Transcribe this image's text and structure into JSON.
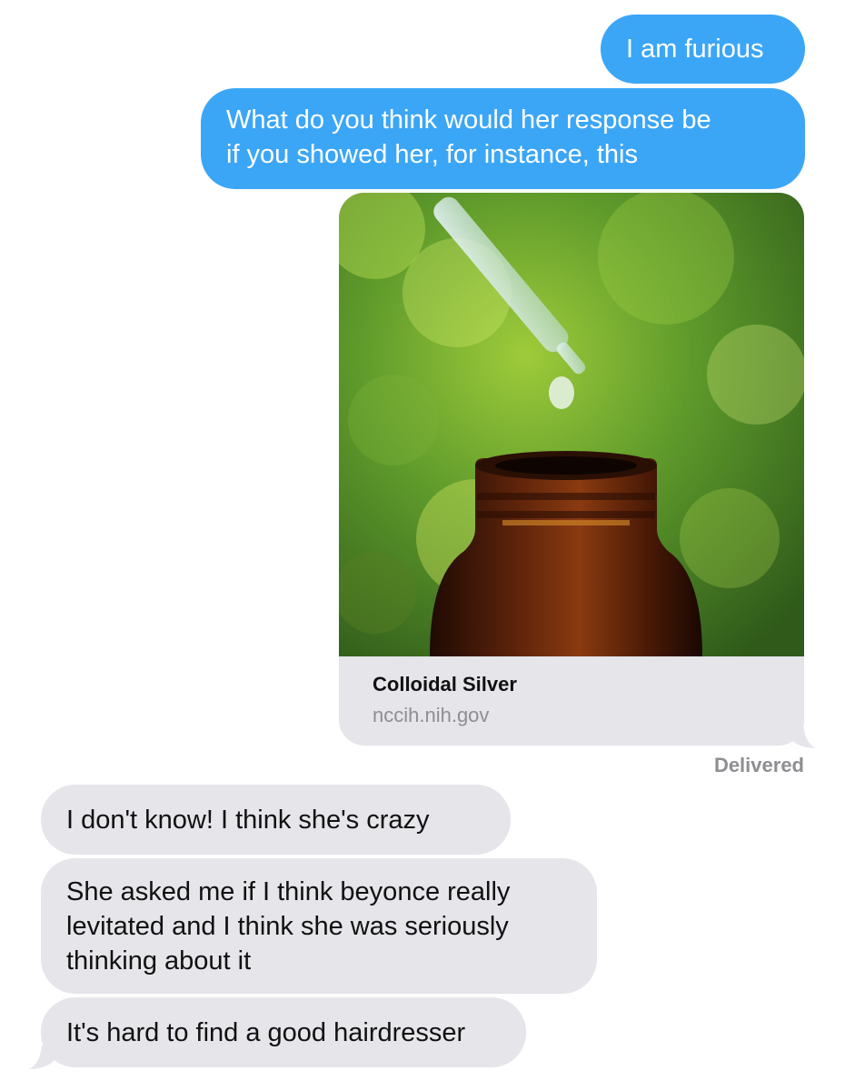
{
  "conversation": {
    "sent": [
      {
        "text": "I am furious"
      },
      {
        "line1": "What do you think would her response be",
        "line2": "if you showed her, for instance, this"
      }
    ],
    "link_preview": {
      "title": "Colloidal Silver",
      "domain": "nccih.nih.gov",
      "image_subject": "dropper-over-amber-bottle"
    },
    "status": "Delivered",
    "received": [
      {
        "text": "I don't know! I think she's crazy"
      },
      {
        "line1": "She asked me if I think beyonce really",
        "line2": "levitated and I think she was seriously",
        "line3": "thinking about it"
      },
      {
        "text": "It's hard to find a good hairdresser"
      }
    ]
  },
  "colors": {
    "sent_bubble": "#3ca6f6",
    "received_bubble": "#e5e5ea",
    "status_text": "#8e8e93"
  }
}
